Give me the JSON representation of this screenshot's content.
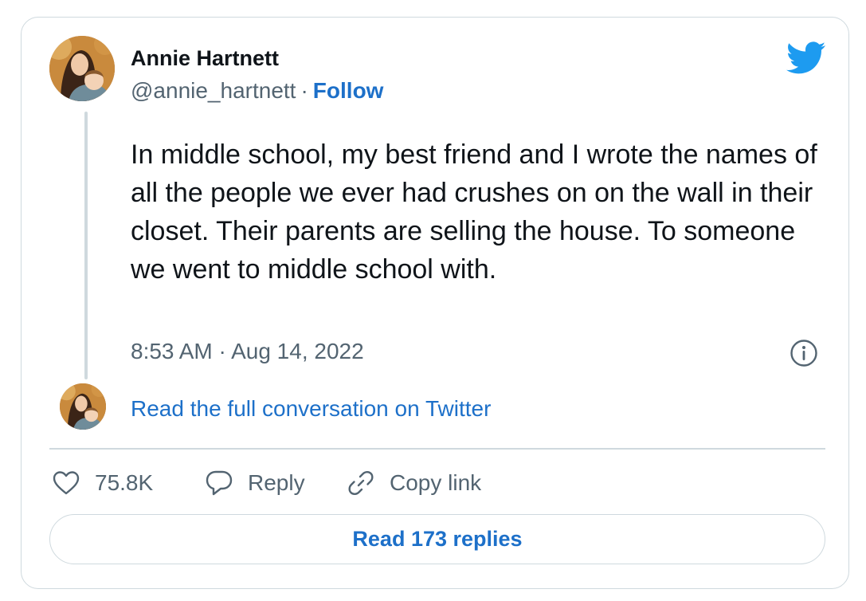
{
  "author": {
    "name": "Annie Hartnett",
    "handle": "@annie_hartnett",
    "separator": "·",
    "follow_label": "Follow"
  },
  "tweet": {
    "text": "In middle school, my best friend and I wrote the names of all the people we ever had crushes on on the wall in their closet. Their parents are selling the house. To someone we went to middle school with.",
    "timestamp": "8:53 AM · Aug 14, 2022"
  },
  "conversation": {
    "link_label": "Read the full conversation on Twitter"
  },
  "actions": {
    "like_count": "75.8K",
    "reply_label": "Reply",
    "copy_link_label": "Copy link"
  },
  "replies_button": {
    "label": "Read 173 replies"
  },
  "icons": {
    "brand": "twitter-bird-icon",
    "info": "info-icon",
    "like": "heart-icon",
    "reply": "speech-bubble-icon",
    "copy": "link-icon"
  },
  "colors": {
    "accent": "#1d70c9",
    "twitter_blue": "#1d9bf0",
    "secondary_text": "#536471",
    "border": "#cfd9de"
  }
}
